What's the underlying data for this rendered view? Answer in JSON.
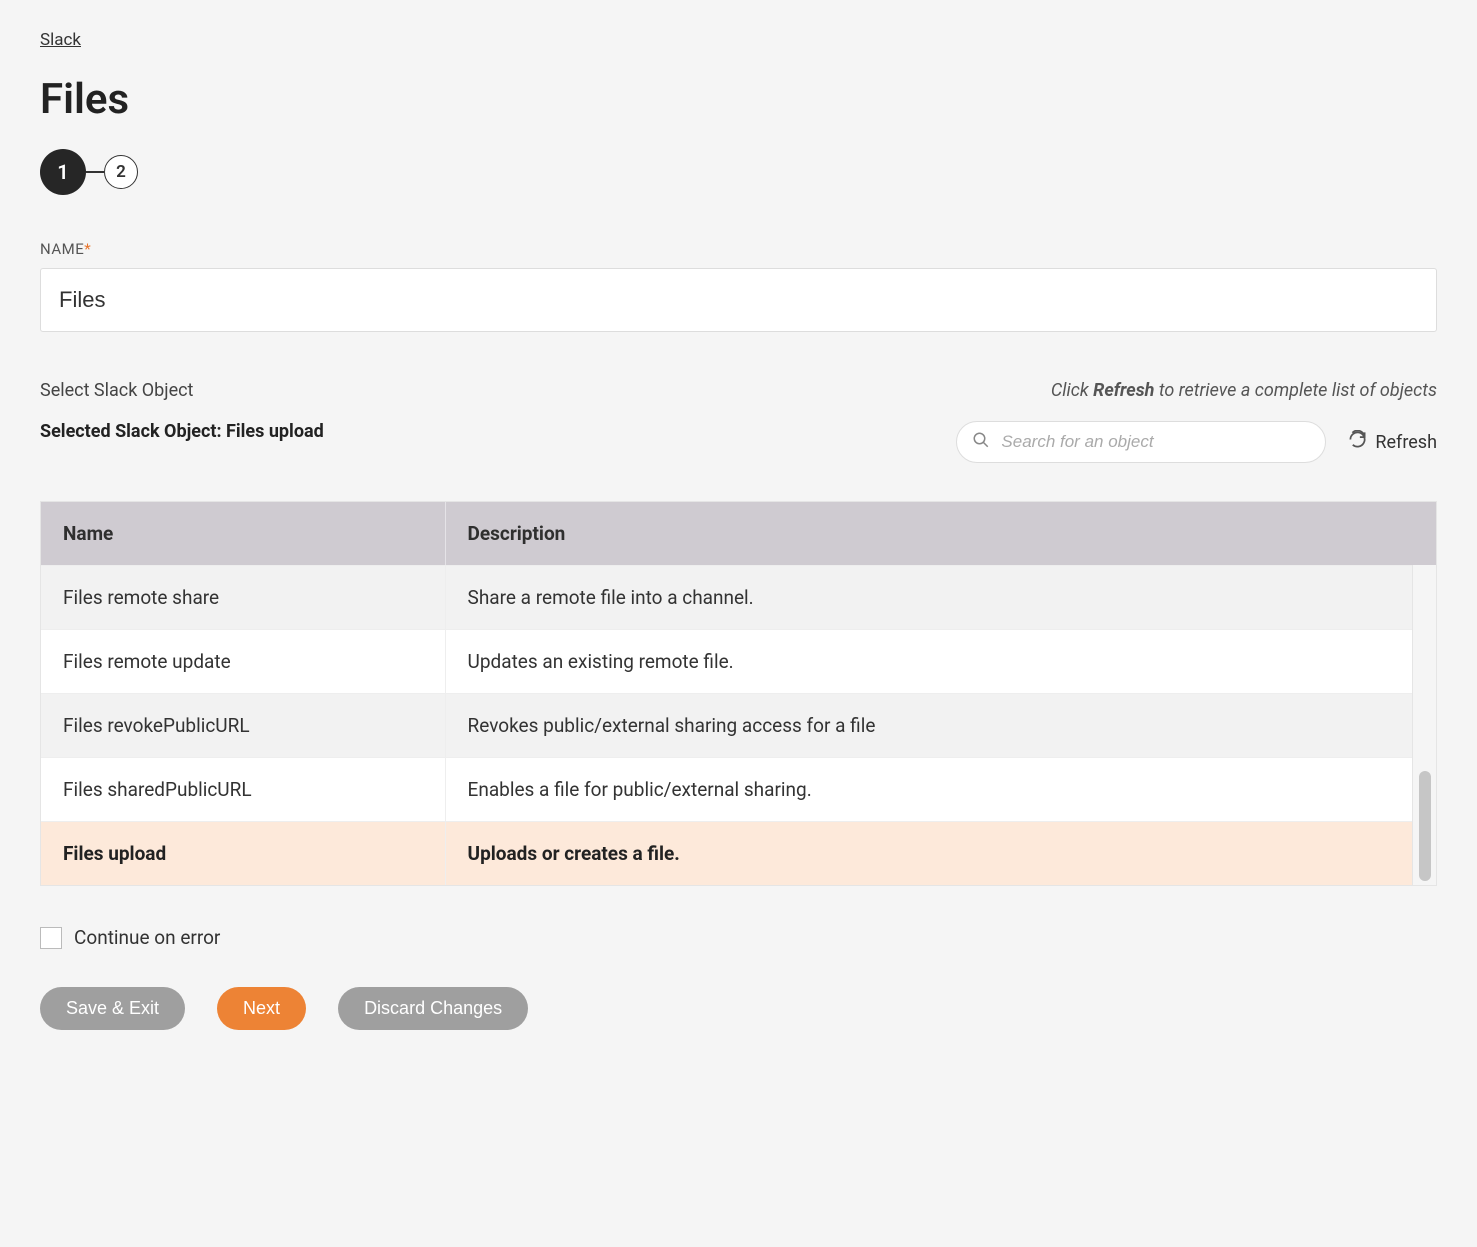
{
  "breadcrumb": {
    "label": "Slack"
  },
  "page": {
    "title": "Files"
  },
  "stepper": {
    "current": "1",
    "next": "2"
  },
  "nameField": {
    "label": "NAME",
    "value": "Files"
  },
  "objectSelect": {
    "label": "Select Slack Object",
    "hint_prefix": "Click ",
    "hint_bold": "Refresh",
    "hint_suffix": " to retrieve a complete list of objects",
    "selected_prefix": "Selected Slack Object: ",
    "selected_value": "Files upload",
    "search_placeholder": "Search for an object",
    "refresh_label": "Refresh"
  },
  "table": {
    "columns": {
      "name": "Name",
      "description": "Description"
    },
    "rows": [
      {
        "name": "Files remote share",
        "description": "Share a remote file into a channel.",
        "selected": false
      },
      {
        "name": "Files remote update",
        "description": "Updates an existing remote file.",
        "selected": false
      },
      {
        "name": "Files revokePublicURL",
        "description": "Revokes public/external sharing access for a file",
        "selected": false
      },
      {
        "name": "Files sharedPublicURL",
        "description": "Enables a file for public/external sharing.",
        "selected": false
      },
      {
        "name": "Files upload",
        "description": "Uploads or creates a file.",
        "selected": true
      }
    ]
  },
  "continueOnError": {
    "label": "Continue on error"
  },
  "buttons": {
    "save_exit": "Save & Exit",
    "next": "Next",
    "discard": "Discard Changes"
  }
}
